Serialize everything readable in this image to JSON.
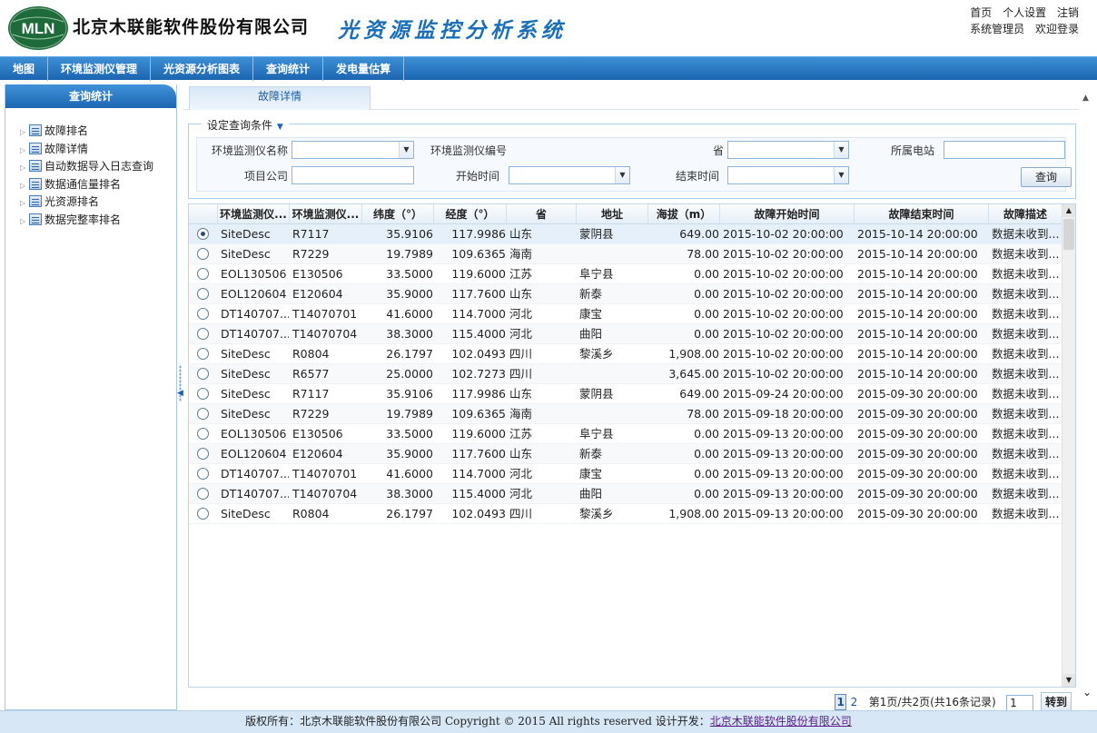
{
  "header": {
    "logo_text": "MLN",
    "company_name": "北京木联能软件股份有限公司",
    "system_name": "光资源监控分析系统",
    "links": {
      "home": "首页",
      "settings": "个人设置",
      "logout": "注销"
    },
    "user": {
      "name": "系统管理员",
      "welcome": "欢迎登录"
    }
  },
  "nav": {
    "items": [
      "地图",
      "环境监测仪管理",
      "光资源分析图表",
      "查询统计",
      "发电量估算"
    ]
  },
  "sidebar": {
    "title": "查询统计",
    "items": [
      "故障排名",
      "故障详情",
      "自动数据导入日志查询",
      "数据通信量排名",
      "光资源排名",
      "数据完整率排名"
    ]
  },
  "tab": {
    "label": "故障详情"
  },
  "query": {
    "legend": "设定查询条件",
    "labels": {
      "device_name": "环境监测仪名称",
      "device_code": "环境监测仪编号",
      "province": "省",
      "station": "所属电站",
      "company": "项目公司",
      "start_time": "开始时间",
      "end_time": "结束时间"
    },
    "button": "查询"
  },
  "table": {
    "columns": [
      "环境监测仪...",
      "环境监测仪...",
      "纬度（°）",
      "经度（°）",
      "省",
      "地址",
      "海拔（m）",
      "故障开始时间",
      "故障结束时间",
      "故障描述"
    ],
    "rows": [
      [
        "SiteDesc",
        "R7117",
        "35.9106",
        "117.9986",
        "山东",
        "蒙阴县",
        "649.00",
        "2015-10-02 20:00:00",
        "2015-10-14 20:00:00",
        "数据未收到..."
      ],
      [
        "SiteDesc",
        "R7229",
        "19.7989",
        "109.6365",
        "海南",
        "",
        "78.00",
        "2015-10-02 20:00:00",
        "2015-10-14 20:00:00",
        "数据未收到..."
      ],
      [
        "EOL130506",
        "E130506",
        "33.5000",
        "119.6000",
        "江苏",
        "阜宁县",
        "0.00",
        "2015-10-02 20:00:00",
        "2015-10-14 20:00:00",
        "数据未收到..."
      ],
      [
        "EOL120604",
        "E120604",
        "35.9000",
        "117.7600",
        "山东",
        "新泰",
        "0.00",
        "2015-10-02 20:00:00",
        "2015-10-14 20:00:00",
        "数据未收到..."
      ],
      [
        "DT140707...",
        "T14070701",
        "41.6000",
        "114.7000",
        "河北",
        "康宝",
        "0.00",
        "2015-10-02 20:00:00",
        "2015-10-14 20:00:00",
        "数据未收到..."
      ],
      [
        "DT140707...",
        "T14070704",
        "38.3000",
        "115.4000",
        "河北",
        "曲阳",
        "0.00",
        "2015-10-02 20:00:00",
        "2015-10-14 20:00:00",
        "数据未收到..."
      ],
      [
        "SiteDesc",
        "R0804",
        "26.1797",
        "102.0493",
        "四川",
        "黎溪乡",
        "1,908.00",
        "2015-10-02 20:00:00",
        "2015-10-14 20:00:00",
        "数据未收到..."
      ],
      [
        "SiteDesc",
        "R6577",
        "25.0000",
        "102.7273",
        "四川",
        "",
        "3,645.00",
        "2015-10-02 20:00:00",
        "2015-10-14 20:00:00",
        "数据未收到..."
      ],
      [
        "SiteDesc",
        "R7117",
        "35.9106",
        "117.9986",
        "山东",
        "蒙阴县",
        "649.00",
        "2015-09-24 20:00:00",
        "2015-09-30 20:00:00",
        "数据未收到..."
      ],
      [
        "SiteDesc",
        "R7229",
        "19.7989",
        "109.6365",
        "海南",
        "",
        "78.00",
        "2015-09-18 20:00:00",
        "2015-09-30 20:00:00",
        "数据未收到..."
      ],
      [
        "EOL130506",
        "E130506",
        "33.5000",
        "119.6000",
        "江苏",
        "阜宁县",
        "0.00",
        "2015-09-13 20:00:00",
        "2015-09-30 20:00:00",
        "数据未收到..."
      ],
      [
        "EOL120604",
        "E120604",
        "35.9000",
        "117.7600",
        "山东",
        "新泰",
        "0.00",
        "2015-09-13 20:00:00",
        "2015-09-30 20:00:00",
        "数据未收到..."
      ],
      [
        "DT140707...",
        "T14070701",
        "41.6000",
        "114.7000",
        "河北",
        "康宝",
        "0.00",
        "2015-09-13 20:00:00",
        "2015-09-30 20:00:00",
        "数据未收到..."
      ],
      [
        "DT140707...",
        "T14070704",
        "38.3000",
        "115.4000",
        "河北",
        "曲阳",
        "0.00",
        "2015-09-13 20:00:00",
        "2015-09-30 20:00:00",
        "数据未收到..."
      ],
      [
        "SiteDesc",
        "R0804",
        "26.1797",
        "102.0493",
        "四川",
        "黎溪乡",
        "1,908.00",
        "2015-09-13 20:00:00",
        "2015-09-30 20:00:00",
        "数据未收到..."
      ]
    ],
    "selected_row": 0
  },
  "pager": {
    "pages": [
      "1",
      "2"
    ],
    "current_page": "1",
    "info": "第1页/共2页(共16条记录)",
    "goto_value": "1",
    "goto_label": "转到"
  },
  "footer": {
    "text": "版权所有：北京木联能软件股份有限公司  Copyright © 2015 All rights reserved 设计开发：",
    "link": "北京木联能软件股份有限公司"
  },
  "colors": {
    "nav_blue": "#1c65b0",
    "system_title": "#1a6fb8",
    "logo_green": "#1f6a3a",
    "footer_bg": "#d7e7f6"
  }
}
